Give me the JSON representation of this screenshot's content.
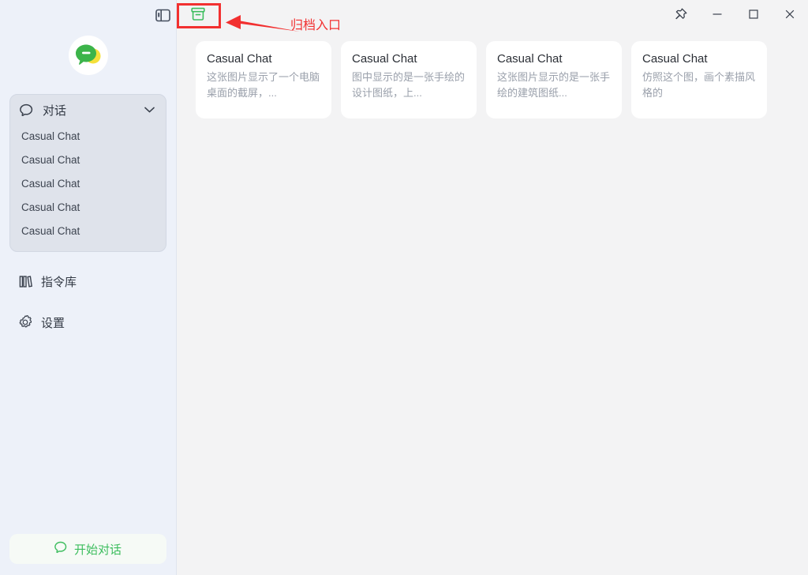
{
  "titlebar": {
    "sidebar_toggle_icon": "sidebar-panel-icon",
    "archive_icon": "archive-box-icon",
    "pin_icon": "pin-icon",
    "minimize_icon": "minimize-icon",
    "maximize_icon": "maximize-icon",
    "close_icon": "close-icon"
  },
  "annotation": {
    "label": "归档入口",
    "color": "#f23030",
    "arrow_icon": "arrow-left-icon"
  },
  "sidebar": {
    "logo_icon": "chat-bubble-logo",
    "logo_colors": {
      "bubble": "#3cb44a",
      "accent": "#f5e03a",
      "ring": "#ffffff"
    },
    "conversations": {
      "icon": "chat-bubble-icon",
      "title": "对话",
      "chevron_icon": "chevron-down-icon",
      "items": [
        {
          "label": "Casual Chat"
        },
        {
          "label": "Casual Chat"
        },
        {
          "label": "Casual Chat"
        },
        {
          "label": "Casual Chat"
        },
        {
          "label": "Casual Chat"
        }
      ]
    },
    "nav": [
      {
        "label": "指令库",
        "icon": "books-icon"
      },
      {
        "label": "设置",
        "icon": "gear-icon"
      }
    ],
    "start_button": {
      "label": "开始对话",
      "icon": "chat-bubble-icon",
      "color": "#3dbd5e"
    }
  },
  "main": {
    "cards": [
      {
        "title": "Casual Chat",
        "desc": "这张图片显示了一个电脑桌面的截屏，..."
      },
      {
        "title": "Casual Chat",
        "desc": "图中显示的是一张手绘的设计图纸，上..."
      },
      {
        "title": "Casual Chat",
        "desc": "这张图片显示的是一张手绘的建筑图纸..."
      },
      {
        "title": "Casual Chat",
        "desc": "仿照这个图，画个素描风格的"
      }
    ]
  },
  "colors": {
    "sidebar_bg": "#edf1f9",
    "main_bg": "#f3f3f4",
    "card_bg": "#ffffff",
    "panel_bg": "#dfe3eb",
    "accent_green": "#3dbd5e",
    "annotation_red": "#f23030"
  }
}
